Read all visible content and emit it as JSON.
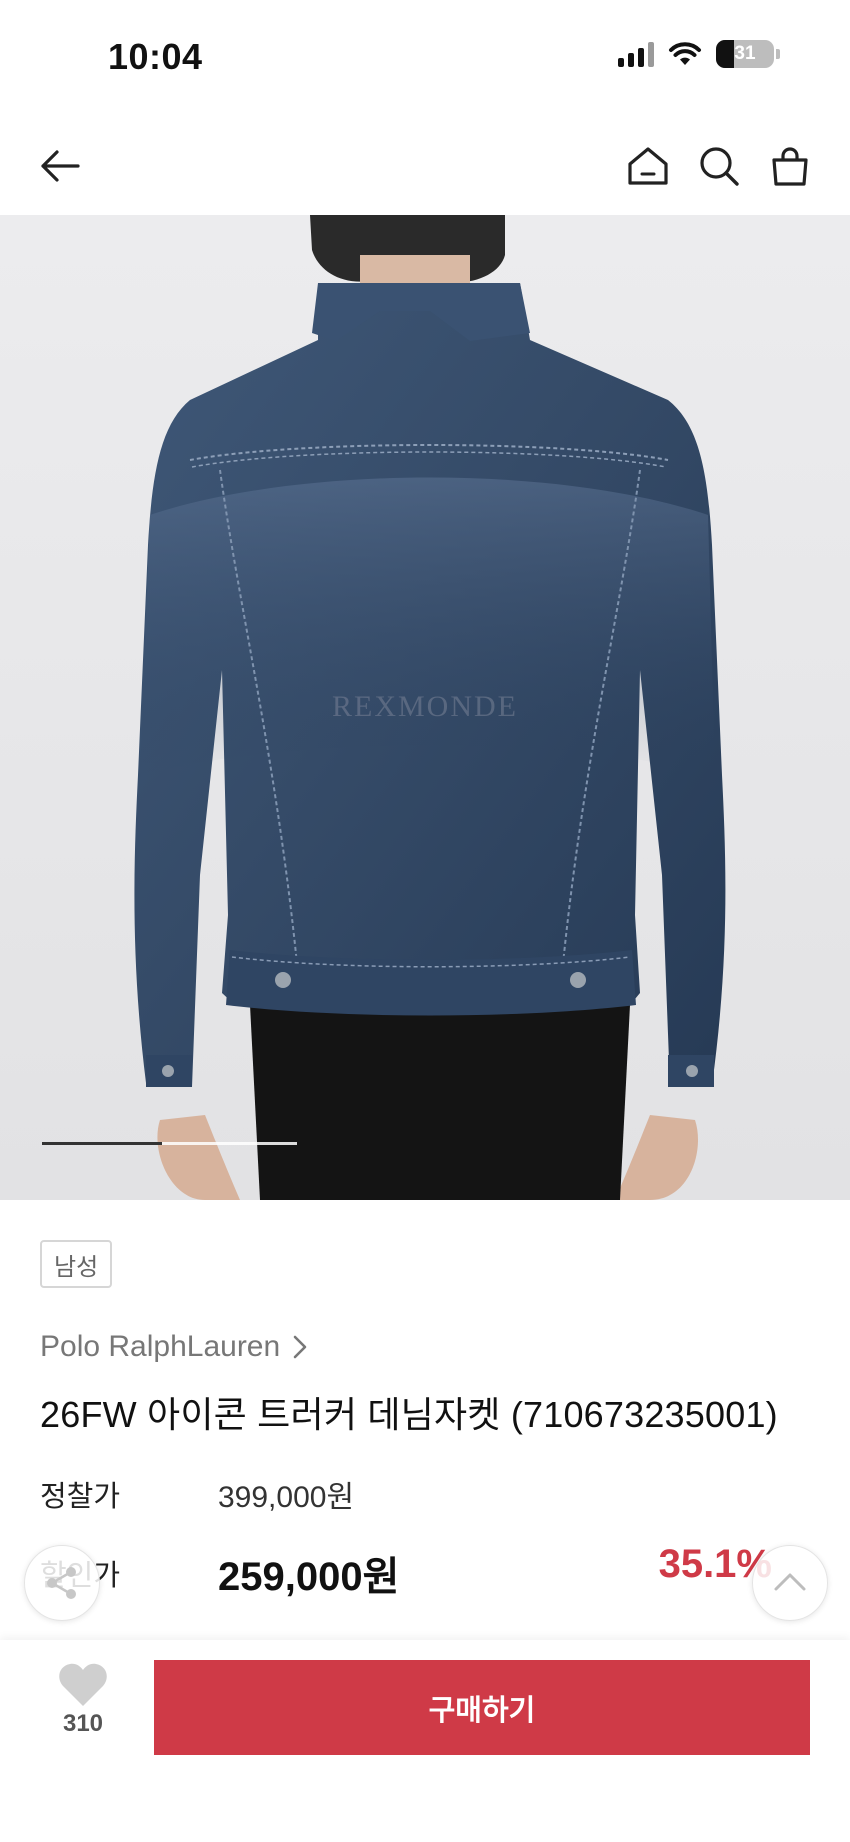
{
  "status_bar": {
    "time": "10:04",
    "battery": "31",
    "battery_level": 0.31,
    "icons": [
      "signal-icon",
      "wifi-icon",
      "battery-icon"
    ]
  },
  "nav": {
    "icons": [
      "back-arrow-icon",
      "home-icon",
      "search-icon",
      "shopping-bag-icon"
    ]
  },
  "gallery": {
    "watermark": "REXMONDE",
    "indicator_progress": 0.47
  },
  "product": {
    "tag": "남성",
    "brand": "Polo RalphLauren",
    "title": "26FW 아이콘 트러커 데님자켓 (710673235001)",
    "list_price_label": "정찰가",
    "list_price": "399,000원",
    "sale_price_label": "할인가",
    "sale_price": "259,000원",
    "discount": "35.1%"
  },
  "floating": {
    "icons": [
      "share-icon",
      "scroll-top-icon"
    ]
  },
  "bottom_bar": {
    "like_count": "310",
    "buy_label": "구매하기"
  },
  "colors": {
    "accent": "#cf3a47",
    "text": "#111111",
    "muted": "#777777",
    "photo_background": "#e9e9eb"
  }
}
